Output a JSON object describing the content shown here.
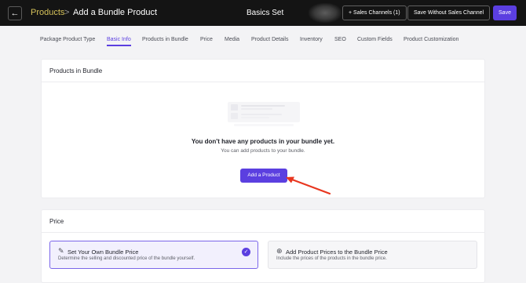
{
  "header": {
    "back_icon": "arrow-left-icon",
    "breadcrumb_root": "Products",
    "breadcrumb_separator": ">",
    "page_title": "Add a Bundle Product",
    "center_title": "Basics Set",
    "sales_channels_label": "+ Sales Channels (1)",
    "save_without_label": "Save Without Sales Channel",
    "save_label": "Save"
  },
  "tabs": [
    {
      "label": "Package Product Type",
      "active": false
    },
    {
      "label": "Basic Info",
      "active": true
    },
    {
      "label": "Products in Bundle",
      "active": false
    },
    {
      "label": "Price",
      "active": false
    },
    {
      "label": "Media",
      "active": false
    },
    {
      "label": "Product Details",
      "active": false
    },
    {
      "label": "Inventory",
      "active": false
    },
    {
      "label": "SEO",
      "active": false
    },
    {
      "label": "Custom Fields",
      "active": false
    },
    {
      "label": "Product Customization",
      "active": false
    }
  ],
  "bundle_section": {
    "title": "Products in Bundle",
    "empty_title": "You don't have any products in your bundle yet.",
    "empty_subtitle": "You can add products to your bundle.",
    "add_button_label": "Add a Product"
  },
  "price_section": {
    "title": "Price",
    "options": [
      {
        "icon": "pencil-icon",
        "title": "Set Your Own Bundle Price",
        "description": "Determine the selling and discounted price of the bundle yourself.",
        "selected": true
      },
      {
        "icon": "plus-circle-icon",
        "title": "Add Product Prices to the Bundle Price",
        "description": "Include the prices of the products in the bundle price.",
        "selected": false
      }
    ]
  },
  "colors": {
    "accent": "#5b3fe0",
    "topbar": "#141414",
    "breadcrumb_root": "#d6c25a",
    "annotation_arrow": "#e8361f"
  }
}
